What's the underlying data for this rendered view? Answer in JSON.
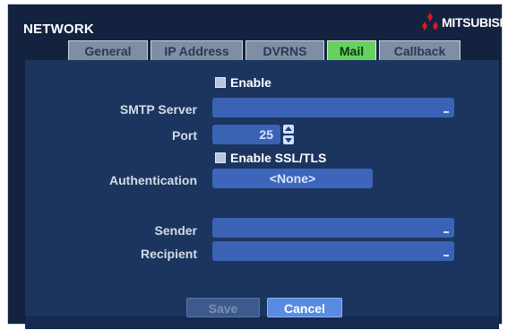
{
  "window": {
    "title": "NETWORK",
    "brand": "MITSUBISHI"
  },
  "tabs": [
    {
      "label": "General",
      "active": false
    },
    {
      "label": "IP Address",
      "active": false
    },
    {
      "label": "DVRNS",
      "active": false
    },
    {
      "label": "Mail",
      "active": true
    },
    {
      "label": "Callback",
      "active": false
    }
  ],
  "form": {
    "enable_label": "Enable",
    "smtp_server_label": "SMTP Server",
    "smtp_server_value": "",
    "port_label": "Port",
    "port_value": "25",
    "ssl_label": "Enable SSL/TLS",
    "authentication_label": "Authentication",
    "authentication_value": "<None>",
    "sender_label": "Sender",
    "sender_value": "",
    "recipient_label": "Recipient",
    "recipient_value": ""
  },
  "buttons": {
    "save": "Save",
    "cancel": "Cancel"
  },
  "colors": {
    "background": "#13233f",
    "panel": "#1b355f",
    "tab": "#7e8ea4",
    "active_tab": "#67d15f",
    "field": "#3a63b6",
    "accent_red": "#e0151f"
  },
  "icons": {
    "brand_logo": "three-diamond-logo",
    "spinner_up": "spin-up-icon",
    "spinner_down": "spin-down-icon",
    "edit": "edit-icon"
  }
}
